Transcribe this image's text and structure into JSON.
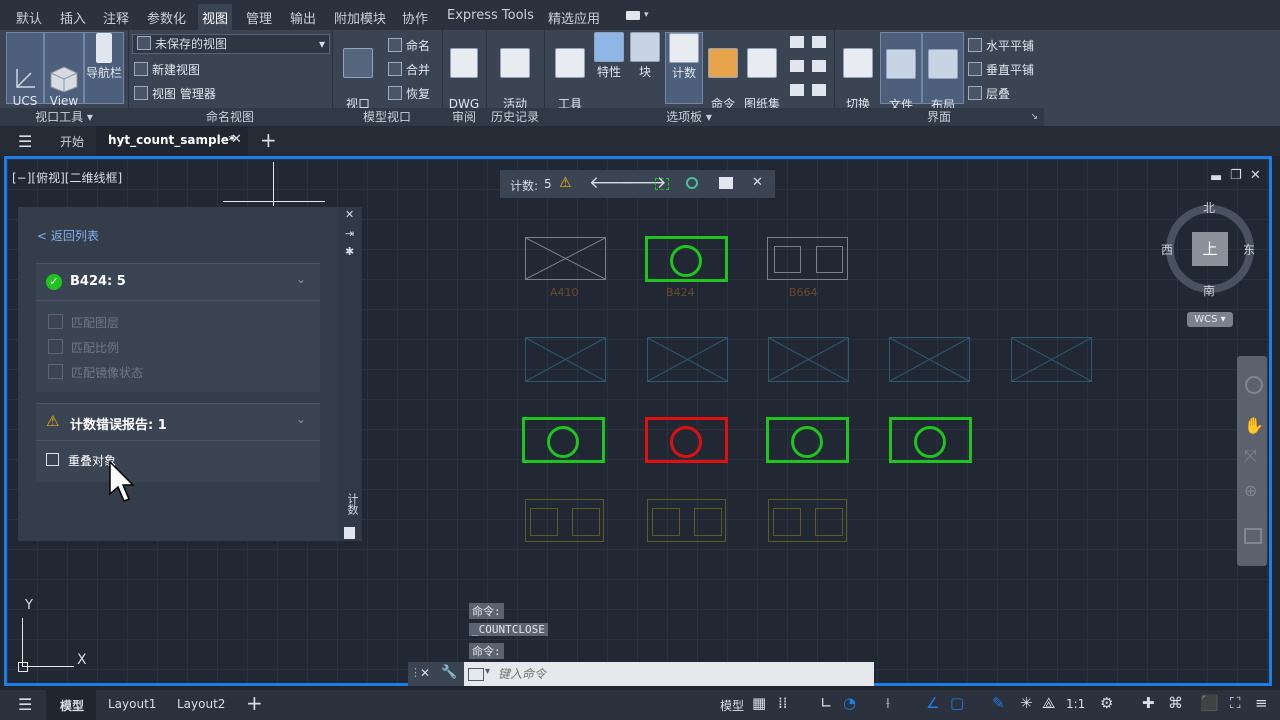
{
  "menu": {
    "tabs": [
      "默认",
      "插入",
      "注释",
      "参数化",
      "视图",
      "管理",
      "输出",
      "附加模块",
      "协作",
      "Express Tools",
      "精选应用"
    ],
    "active_index": 4
  },
  "ribbon": {
    "viewport_tools": {
      "ucs": "UCS\n图标",
      "viewcube": "View\nCube",
      "navbar": "导航栏",
      "title": "视口工具"
    },
    "named_views": {
      "dropdown": "未保存的视图",
      "new_view": "新建视图",
      "view_manager": "视图 管理器",
      "title": "命名视图"
    },
    "model_viewports": {
      "config": "视口\n配置",
      "name": "命名",
      "join": "合并",
      "restore": "恢复",
      "title": "模型视口"
    },
    "compare": {
      "dwg_compare": "DWG\n比较",
      "title": "审阅"
    },
    "history": {
      "activity": "活动\n见解",
      "title": "历史记录"
    },
    "palettes": {
      "tool_palette": "工具\n选项板",
      "properties": "特性",
      "block": "块",
      "count": "计数",
      "command_macro": "命令\n宏",
      "sheet_set": "图纸集\n管理器",
      "title": "选项板"
    },
    "interface": {
      "switch_window": "切换\n窗口",
      "file_tabs": "文件\n选项卡",
      "layout_tabs": "布局\n选项卡",
      "tile_h": "水平平铺",
      "tile_v": "垂直平铺",
      "cascade": "层叠",
      "title": "界面"
    }
  },
  "doc_tabs": {
    "start": "开始",
    "file": "hyt_count_sample*"
  },
  "viewport": {
    "label": "[−][俯视][二维线框]"
  },
  "count_toolbar": {
    "label": "计数:",
    "count": "5"
  },
  "count_panel": {
    "back": "< 返回列表",
    "block_header": "B424: 5",
    "options": [
      "匹配图层",
      "匹配比例",
      "匹配镜像状态"
    ],
    "error_header": "计数错误报告: 1",
    "error_item": "重叠对象",
    "side_label": "计数"
  },
  "viewcube": {
    "north": "北",
    "south": "南",
    "east": "东",
    "west": "西",
    "top": "上",
    "wcs": "WCS"
  },
  "drawing_labels": [
    "A410",
    "B424",
    "B664"
  ],
  "ucs_axes": {
    "x": "X",
    "y": "Y"
  },
  "command": {
    "history": [
      "命令:",
      "_COUNTCLOSE",
      "命令:"
    ],
    "placeholder": "键入命令"
  },
  "status": {
    "model_tab": "模型",
    "layout1": "Layout1",
    "layout2": "Layout2",
    "model_label": "模型",
    "scale": "1:1"
  },
  "colors": {
    "accent": "#1d7ee6",
    "green": "#1fc41f",
    "red": "#e01010",
    "warn": "#f0b400"
  }
}
